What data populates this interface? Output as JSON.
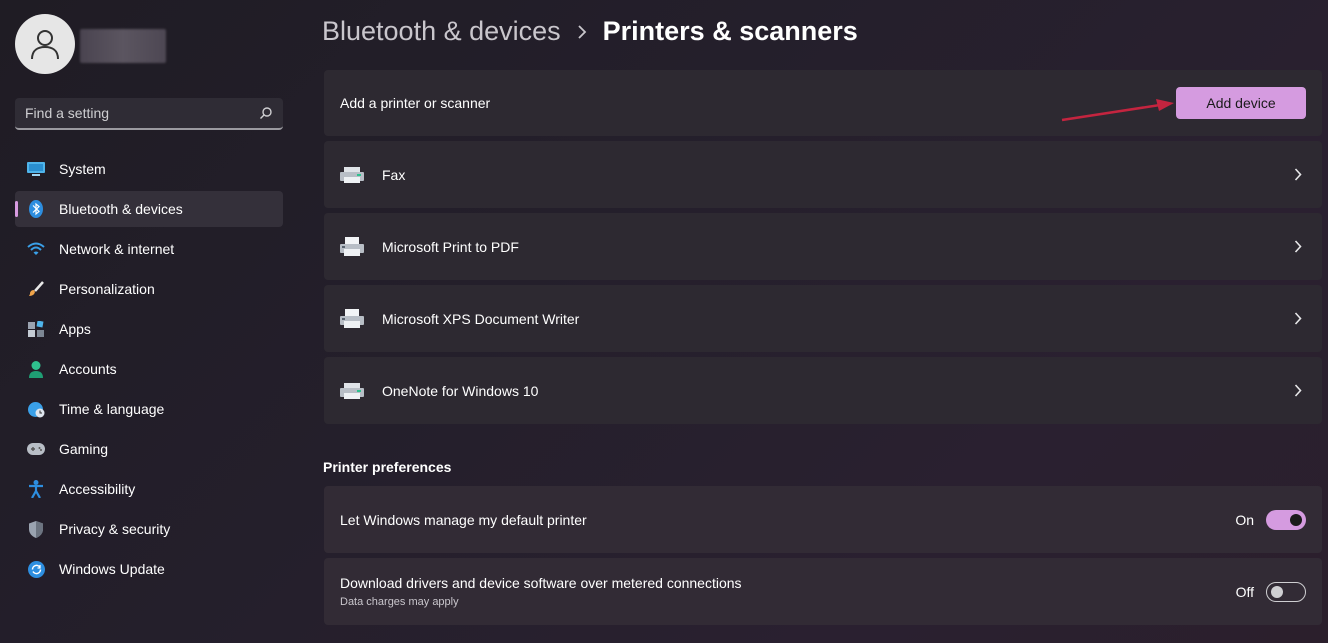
{
  "sidebar": {
    "search": {
      "placeholder": "Find a setting"
    },
    "items": [
      {
        "label": "System",
        "icon": "monitor-icon"
      },
      {
        "label": "Bluetooth & devices",
        "icon": "bluetooth-icon",
        "active": true
      },
      {
        "label": "Network & internet",
        "icon": "wifi-icon"
      },
      {
        "label": "Personalization",
        "icon": "brush-icon"
      },
      {
        "label": "Apps",
        "icon": "apps-icon"
      },
      {
        "label": "Accounts",
        "icon": "person-icon"
      },
      {
        "label": "Time & language",
        "icon": "globe-clock-icon"
      },
      {
        "label": "Gaming",
        "icon": "gamepad-icon"
      },
      {
        "label": "Accessibility",
        "icon": "accessibility-icon"
      },
      {
        "label": "Privacy & security",
        "icon": "shield-icon"
      },
      {
        "label": "Windows Update",
        "icon": "update-icon"
      }
    ]
  },
  "breadcrumb": {
    "parent": "Bluetooth & devices",
    "current": "Printers & scanners"
  },
  "add_section": {
    "label": "Add a printer or scanner",
    "button": "Add device"
  },
  "devices": [
    {
      "name": "Fax",
      "icon": "fax-printer-icon"
    },
    {
      "name": "Microsoft Print to PDF",
      "icon": "printer-icon"
    },
    {
      "name": "Microsoft XPS Document Writer",
      "icon": "printer-icon"
    },
    {
      "name": "OneNote for Windows 10",
      "icon": "printer-icon"
    }
  ],
  "preferences": {
    "title": "Printer preferences",
    "items": [
      {
        "label": "Let Windows manage my default printer",
        "state": "On"
      },
      {
        "label": "Download drivers and device software over metered connections",
        "sublabel": "Data charges may apply",
        "state": "Off"
      }
    ]
  },
  "colors": {
    "accent": "#d59be0",
    "annotation_arrow": "#c4243f"
  }
}
